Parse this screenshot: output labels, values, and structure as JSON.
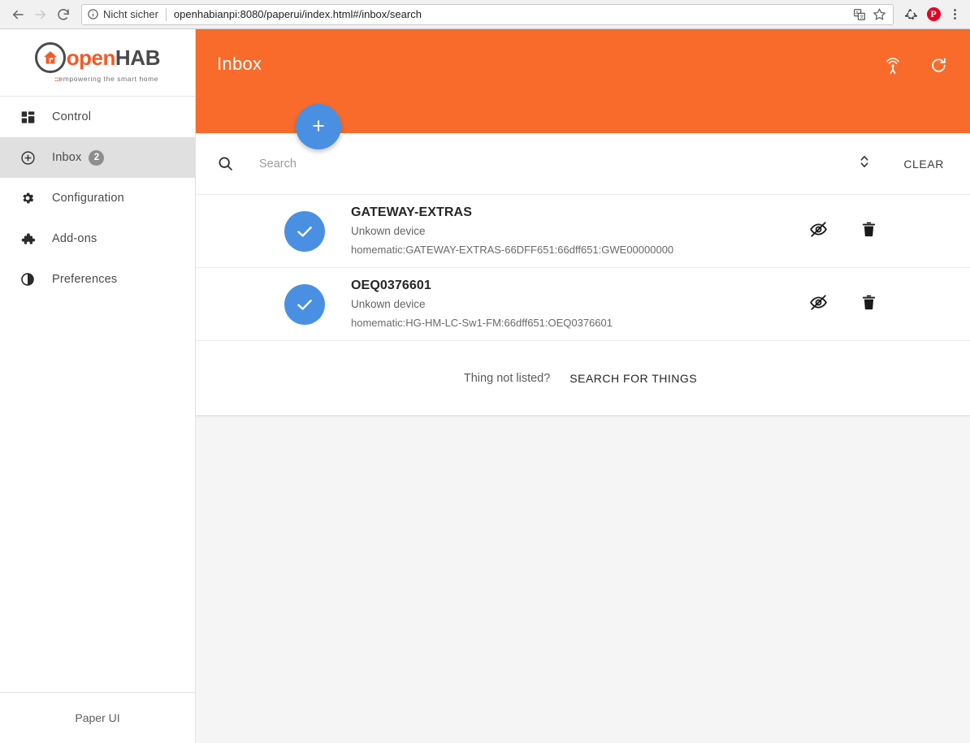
{
  "browser": {
    "back_icon": "back-arrow-icon",
    "forward_icon": "forward-arrow-icon",
    "reload_icon": "reload-icon",
    "security_label": "Nicht sicher",
    "url": "openhabianpi:8080/paperui/index.html#/inbox/search",
    "url_host": "openhabianpi",
    "translate_icon": "translate-icon",
    "bookmark_icon": "star-icon",
    "extension_icon": "recycle-extension-icon",
    "pinterest_icon": "pinterest-icon",
    "pinterest_letter": "P",
    "menu_icon": "three-dot-menu-icon"
  },
  "sidebar": {
    "logo": {
      "open_text": "open",
      "hab_text": "HAB",
      "tagline_bars": ":::",
      "tagline": "empowering the smart home"
    },
    "items": [
      {
        "label": "Control",
        "icon": "dashboard-grid-icon",
        "active": false,
        "badge": null
      },
      {
        "label": "Inbox",
        "icon": "plus-circle-icon",
        "active": true,
        "badge": "2"
      },
      {
        "label": "Configuration",
        "icon": "gear-icon",
        "active": false,
        "badge": null
      },
      {
        "label": "Add-ons",
        "icon": "puzzle-piece-icon",
        "active": false,
        "badge": null
      },
      {
        "label": "Preferences",
        "icon": "contrast-circle-icon",
        "active": false,
        "badge": null
      }
    ],
    "footer_label": "Paper UI"
  },
  "appbar": {
    "title": "Inbox",
    "accent_color": "#f96b2b",
    "scan_icon": "broadcast-antenna-icon",
    "refresh_icon": "refresh-icon"
  },
  "fab": {
    "label": "+",
    "icon": "plus-icon",
    "color": "#4a90e2"
  },
  "search": {
    "icon": "search-icon",
    "placeholder": "Search",
    "value": "",
    "sort_icon": "sort-updown-icon",
    "clear_label": "CLEAR"
  },
  "things": [
    {
      "title": "GATEWAY-EXTRAS",
      "subtitle": "Unkown device",
      "uid": "homematic:GATEWAY-EXTRAS-66DFF651:66dff651:GWE00000000",
      "avatar_icon": "check-circle-icon",
      "hide_icon": "eye-off-icon",
      "delete_icon": "trash-icon"
    },
    {
      "title": "OEQ0376601",
      "subtitle": "Unkown device",
      "uid": "homematic:HG-HM-LC-Sw1-FM:66dff651:OEQ0376601",
      "avatar_icon": "check-circle-icon",
      "hide_icon": "eye-off-icon",
      "delete_icon": "trash-icon"
    }
  ],
  "footer": {
    "not_listed_text": "Thing not listed?",
    "search_things_label": "SEARCH FOR THINGS"
  }
}
